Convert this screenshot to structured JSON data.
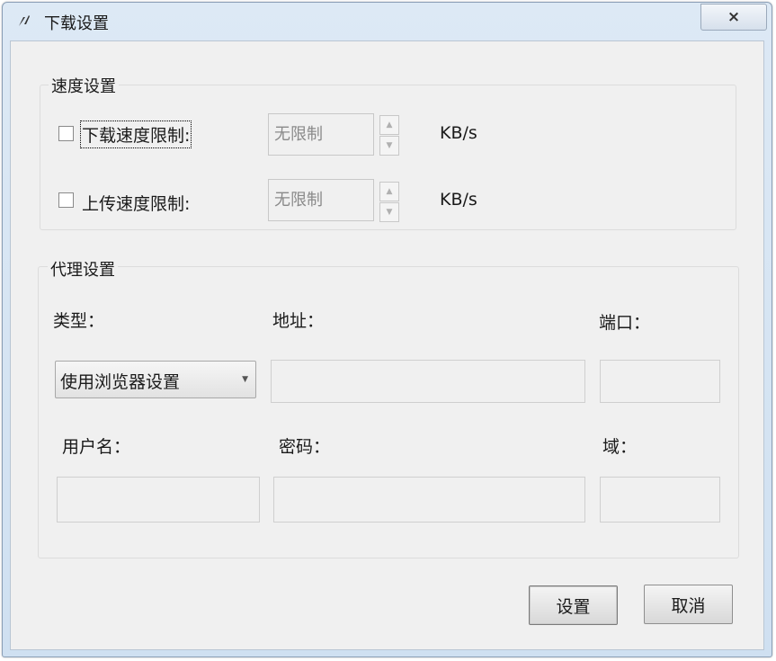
{
  "window": {
    "title": "下载设置",
    "close_label": "×"
  },
  "speed": {
    "group_title": "速度设置",
    "download": {
      "label": "下载速度限制:",
      "checked": false,
      "value": "无限制",
      "unit": "KB/s"
    },
    "upload": {
      "label": "上传速度限制:",
      "checked": false,
      "value": "无限制",
      "unit": "KB/s"
    },
    "spin_up": "▲",
    "spin_down": "▼"
  },
  "proxy": {
    "group_title": "代理设置",
    "type_label": "类型：",
    "type_value": "使用浏览器设置",
    "type_arrow": "▼",
    "address_label": "地址：",
    "address_value": "",
    "port_label": "端口：",
    "port_value": "",
    "username_label": "用户名：",
    "username_value": "",
    "password_label": "密码：",
    "password_value": "",
    "domain_label": "域：",
    "domain_value": ""
  },
  "buttons": {
    "ok": "设置",
    "cancel": "取消"
  }
}
